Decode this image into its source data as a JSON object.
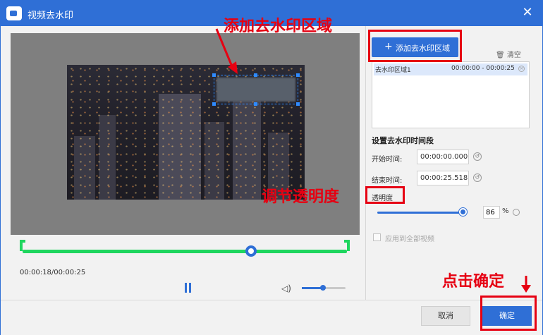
{
  "dialog": {
    "title": "视频去水印",
    "close": "✕"
  },
  "player": {
    "time": "00:00:18/00:00:25"
  },
  "panel": {
    "add_label": "添加去水印区域",
    "clear_label": "清空",
    "list": [
      {
        "name": "去水印区域1",
        "start": "00:00:00",
        "end": "00:00:25"
      }
    ],
    "section_title": "设置去水印时间段",
    "start_label": "开始时间:",
    "start_value": "00:00:00.000",
    "end_label": "结束时间:",
    "end_value": "00:00:25.518",
    "opacity_label": "透明度",
    "opacity_value": "86",
    "opacity_unit": "%",
    "apply_all": "应用到全部视频"
  },
  "footer": {
    "cancel": "取消",
    "ok": "确定"
  },
  "annotations": {
    "top": "添加去水印区域",
    "middle": "调节透明度",
    "bottom": "点击确定"
  },
  "colors": {
    "accent": "#2f6fd6",
    "annotation": "#e60012",
    "timeline": "#1fd65f"
  }
}
